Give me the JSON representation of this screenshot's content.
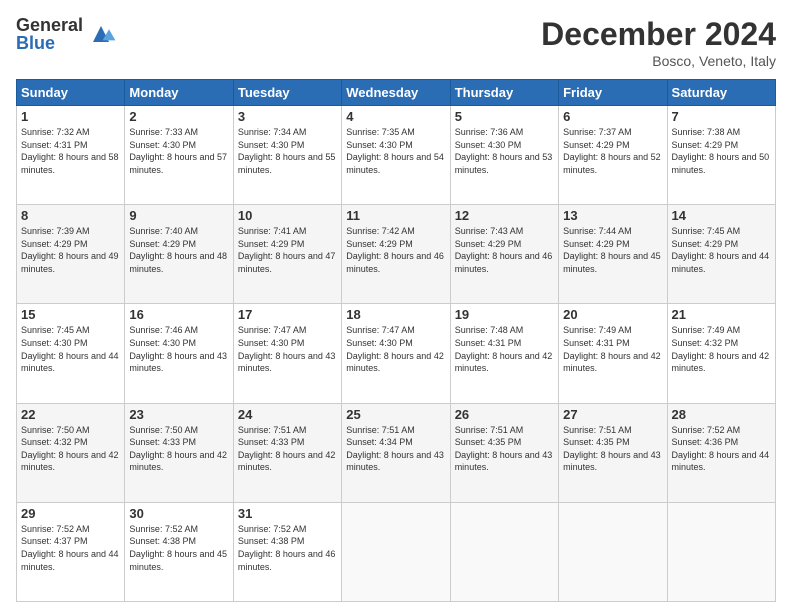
{
  "header": {
    "logo_general": "General",
    "logo_blue": "Blue",
    "month_title": "December 2024",
    "location": "Bosco, Veneto, Italy"
  },
  "weekdays": [
    "Sunday",
    "Monday",
    "Tuesday",
    "Wednesday",
    "Thursday",
    "Friday",
    "Saturday"
  ],
  "weeks": [
    [
      {
        "day": "1",
        "sunrise": "7:32 AM",
        "sunset": "4:31 PM",
        "daylight": "8 hours and 58 minutes."
      },
      {
        "day": "2",
        "sunrise": "7:33 AM",
        "sunset": "4:30 PM",
        "daylight": "8 hours and 57 minutes."
      },
      {
        "day": "3",
        "sunrise": "7:34 AM",
        "sunset": "4:30 PM",
        "daylight": "8 hours and 55 minutes."
      },
      {
        "day": "4",
        "sunrise": "7:35 AM",
        "sunset": "4:30 PM",
        "daylight": "8 hours and 54 minutes."
      },
      {
        "day": "5",
        "sunrise": "7:36 AM",
        "sunset": "4:30 PM",
        "daylight": "8 hours and 53 minutes."
      },
      {
        "day": "6",
        "sunrise": "7:37 AM",
        "sunset": "4:29 PM",
        "daylight": "8 hours and 52 minutes."
      },
      {
        "day": "7",
        "sunrise": "7:38 AM",
        "sunset": "4:29 PM",
        "daylight": "8 hours and 50 minutes."
      }
    ],
    [
      {
        "day": "8",
        "sunrise": "7:39 AM",
        "sunset": "4:29 PM",
        "daylight": "8 hours and 49 minutes."
      },
      {
        "day": "9",
        "sunrise": "7:40 AM",
        "sunset": "4:29 PM",
        "daylight": "8 hours and 48 minutes."
      },
      {
        "day": "10",
        "sunrise": "7:41 AM",
        "sunset": "4:29 PM",
        "daylight": "8 hours and 47 minutes."
      },
      {
        "day": "11",
        "sunrise": "7:42 AM",
        "sunset": "4:29 PM",
        "daylight": "8 hours and 46 minutes."
      },
      {
        "day": "12",
        "sunrise": "7:43 AM",
        "sunset": "4:29 PM",
        "daylight": "8 hours and 46 minutes."
      },
      {
        "day": "13",
        "sunrise": "7:44 AM",
        "sunset": "4:29 PM",
        "daylight": "8 hours and 45 minutes."
      },
      {
        "day": "14",
        "sunrise": "7:45 AM",
        "sunset": "4:29 PM",
        "daylight": "8 hours and 44 minutes."
      }
    ],
    [
      {
        "day": "15",
        "sunrise": "7:45 AM",
        "sunset": "4:30 PM",
        "daylight": "8 hours and 44 minutes."
      },
      {
        "day": "16",
        "sunrise": "7:46 AM",
        "sunset": "4:30 PM",
        "daylight": "8 hours and 43 minutes."
      },
      {
        "day": "17",
        "sunrise": "7:47 AM",
        "sunset": "4:30 PM",
        "daylight": "8 hours and 43 minutes."
      },
      {
        "day": "18",
        "sunrise": "7:47 AM",
        "sunset": "4:30 PM",
        "daylight": "8 hours and 42 minutes."
      },
      {
        "day": "19",
        "sunrise": "7:48 AM",
        "sunset": "4:31 PM",
        "daylight": "8 hours and 42 minutes."
      },
      {
        "day": "20",
        "sunrise": "7:49 AM",
        "sunset": "4:31 PM",
        "daylight": "8 hours and 42 minutes."
      },
      {
        "day": "21",
        "sunrise": "7:49 AM",
        "sunset": "4:32 PM",
        "daylight": "8 hours and 42 minutes."
      }
    ],
    [
      {
        "day": "22",
        "sunrise": "7:50 AM",
        "sunset": "4:32 PM",
        "daylight": "8 hours and 42 minutes."
      },
      {
        "day": "23",
        "sunrise": "7:50 AM",
        "sunset": "4:33 PM",
        "daylight": "8 hours and 42 minutes."
      },
      {
        "day": "24",
        "sunrise": "7:51 AM",
        "sunset": "4:33 PM",
        "daylight": "8 hours and 42 minutes."
      },
      {
        "day": "25",
        "sunrise": "7:51 AM",
        "sunset": "4:34 PM",
        "daylight": "8 hours and 43 minutes."
      },
      {
        "day": "26",
        "sunrise": "7:51 AM",
        "sunset": "4:35 PM",
        "daylight": "8 hours and 43 minutes."
      },
      {
        "day": "27",
        "sunrise": "7:51 AM",
        "sunset": "4:35 PM",
        "daylight": "8 hours and 43 minutes."
      },
      {
        "day": "28",
        "sunrise": "7:52 AM",
        "sunset": "4:36 PM",
        "daylight": "8 hours and 44 minutes."
      }
    ],
    [
      {
        "day": "29",
        "sunrise": "7:52 AM",
        "sunset": "4:37 PM",
        "daylight": "8 hours and 44 minutes."
      },
      {
        "day": "30",
        "sunrise": "7:52 AM",
        "sunset": "4:38 PM",
        "daylight": "8 hours and 45 minutes."
      },
      {
        "day": "31",
        "sunrise": "7:52 AM",
        "sunset": "4:38 PM",
        "daylight": "8 hours and 46 minutes."
      },
      null,
      null,
      null,
      null
    ]
  ],
  "labels": {
    "sunrise": "Sunrise:",
    "sunset": "Sunset:",
    "daylight": "Daylight:"
  }
}
